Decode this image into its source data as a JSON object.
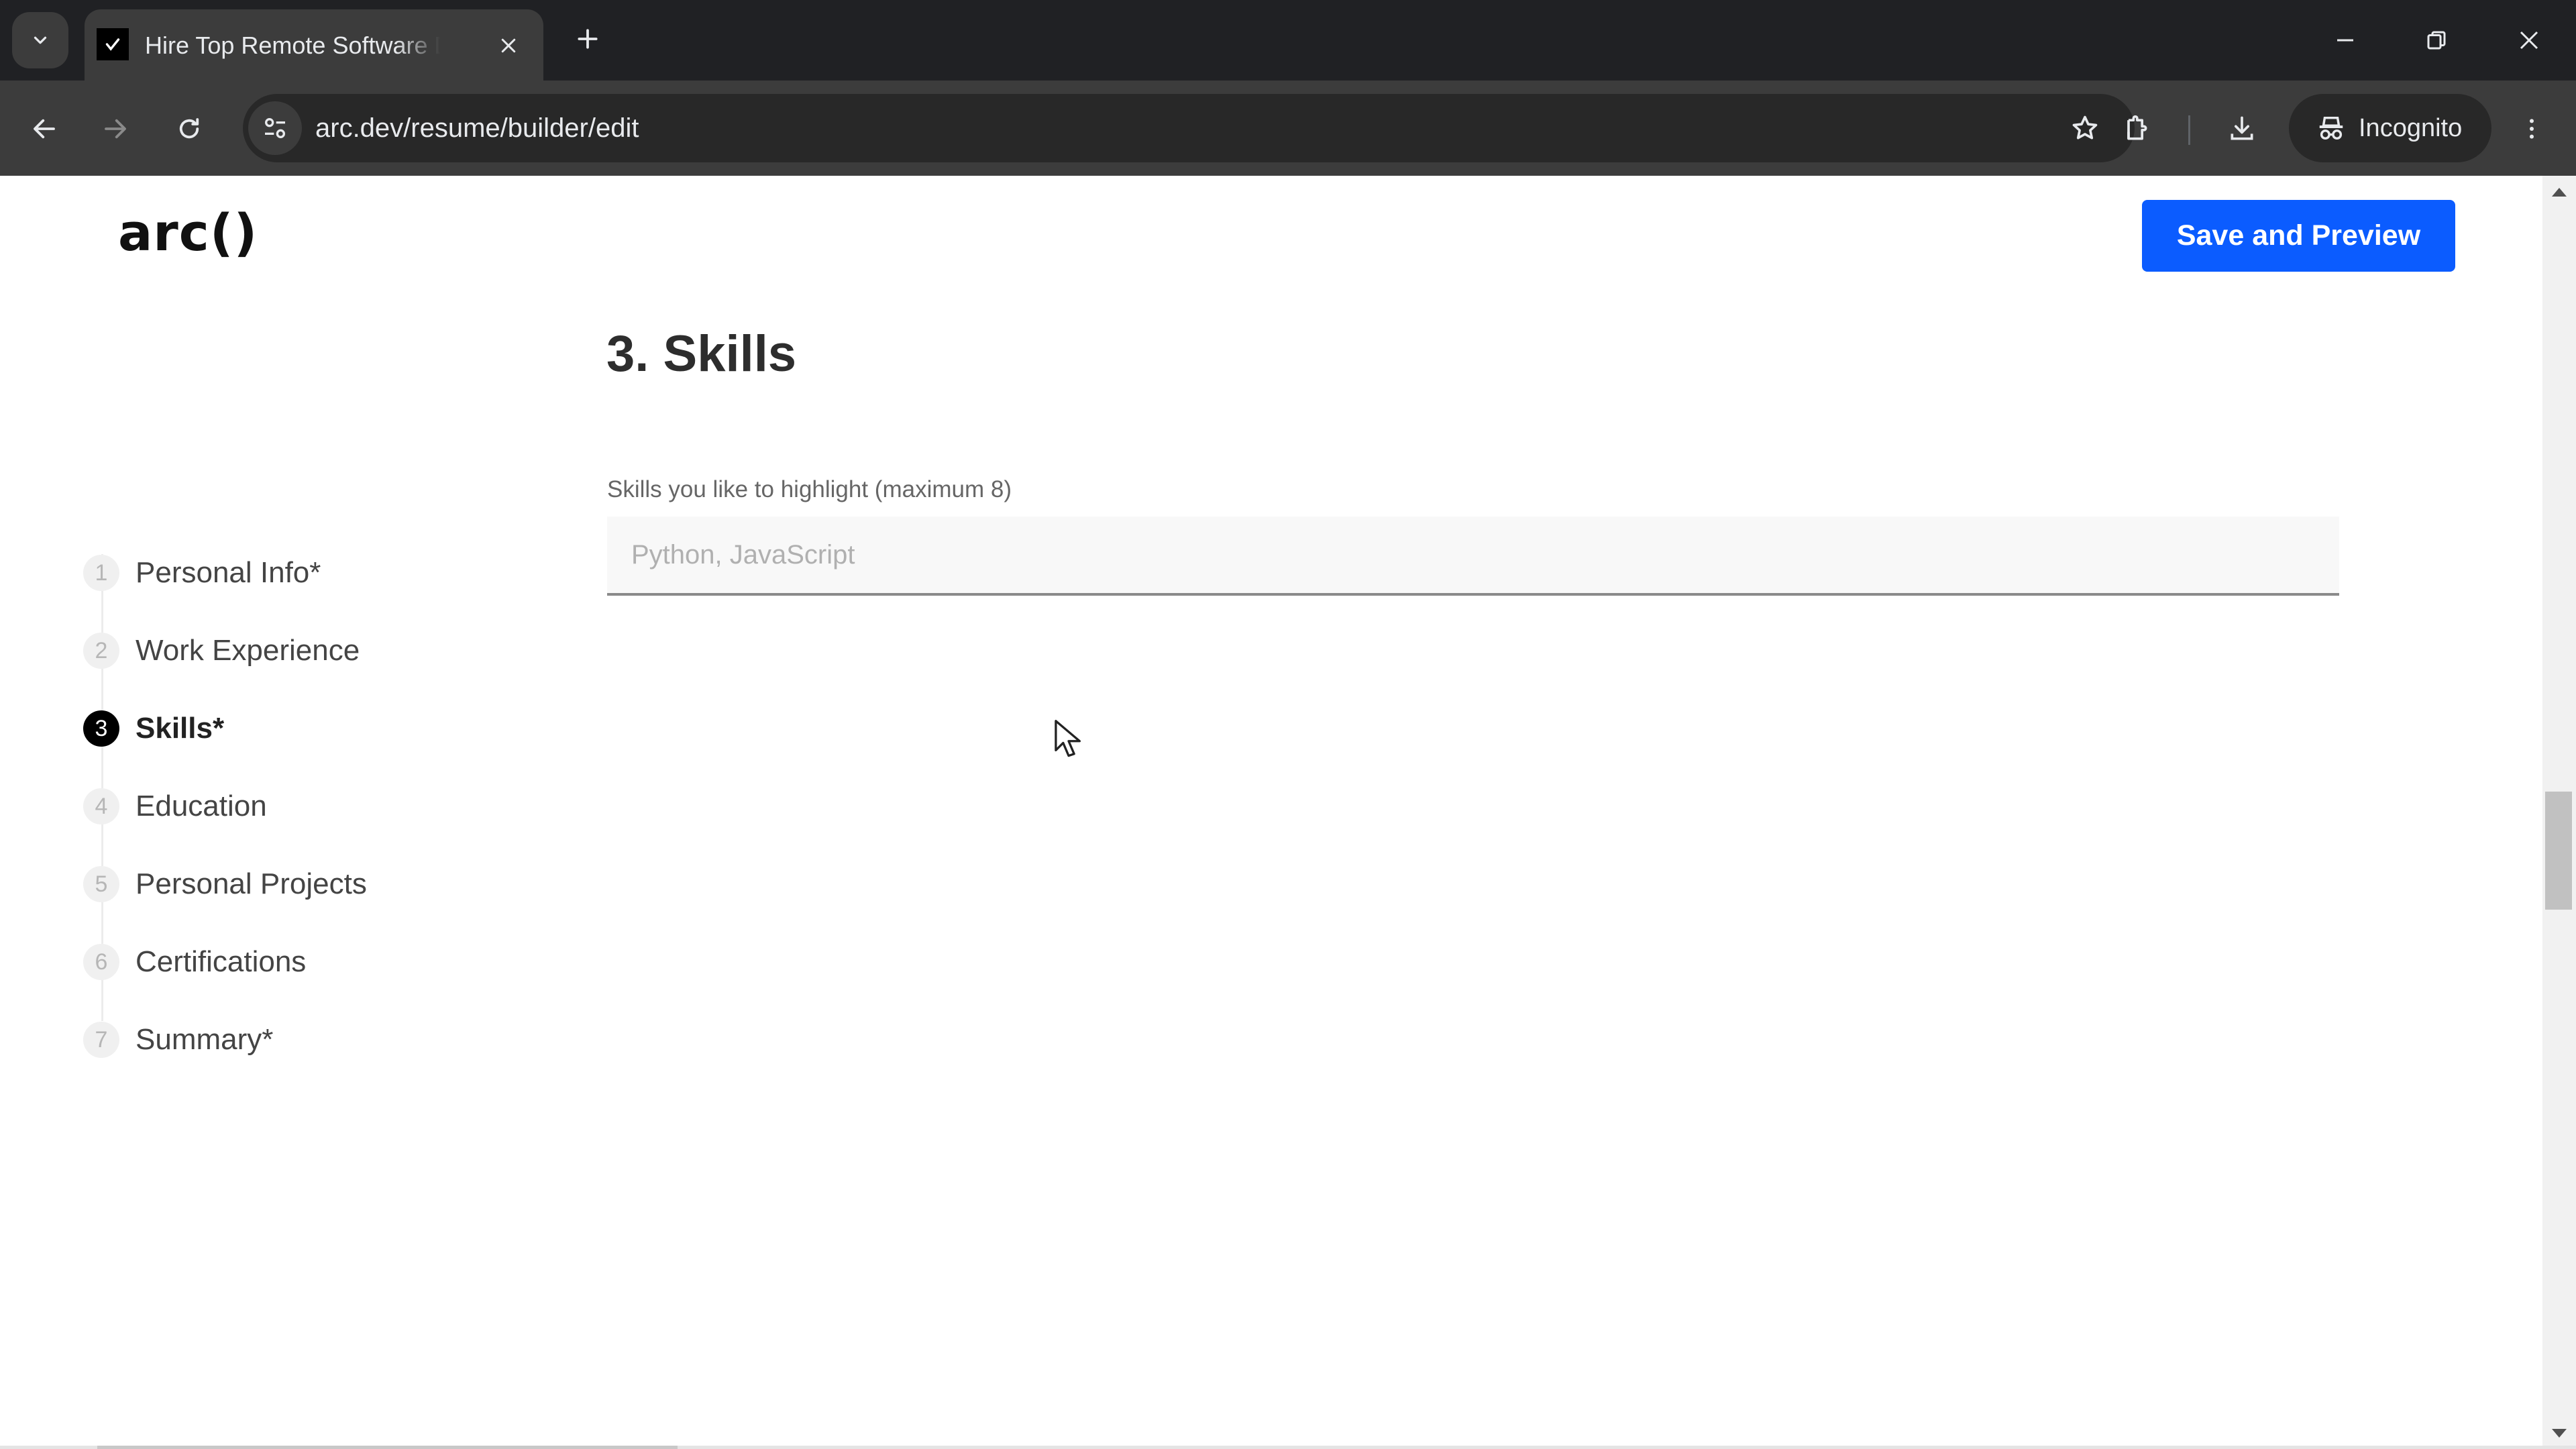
{
  "browser": {
    "tab_title": "Hire Top Remote Software Developers",
    "url": "arc.dev/resume/builder/edit",
    "incognito_label": "Incognito",
    "icons": {
      "tab_search": "chevron-down-icon",
      "favicon": "arc-favicon-icon",
      "tab_close": "close-icon",
      "new_tab": "plus-icon",
      "minimize": "minimize-icon",
      "restore": "restore-icon",
      "close_window": "close-icon",
      "back": "arrow-left-icon",
      "forward": "arrow-right-icon",
      "reload": "reload-icon",
      "site_info": "tune-icon",
      "bookmark": "star-icon",
      "extensions": "puzzle-icon",
      "downloads": "download-icon",
      "incognito": "incognito-icon",
      "menu": "kebab-menu-icon"
    }
  },
  "header": {
    "logo": "arc()",
    "save_button": "Save and Preview",
    "accent_color": "#0b5cff"
  },
  "steps": [
    {
      "number": "1",
      "label": "Personal Info*",
      "active": false
    },
    {
      "number": "2",
      "label": "Work Experience",
      "active": false
    },
    {
      "number": "3",
      "label": "Skills*",
      "active": true
    },
    {
      "number": "4",
      "label": "Education",
      "active": false
    },
    {
      "number": "5",
      "label": "Personal Projects",
      "active": false
    },
    {
      "number": "6",
      "label": "Certifications",
      "active": false
    },
    {
      "number": "7",
      "label": "Summary*",
      "active": false
    }
  ],
  "main": {
    "section_title": "3. Skills",
    "skills_field": {
      "label": "Skills you like to highlight (maximum 8)",
      "placeholder": "Python, JavaScript",
      "value": ""
    }
  }
}
